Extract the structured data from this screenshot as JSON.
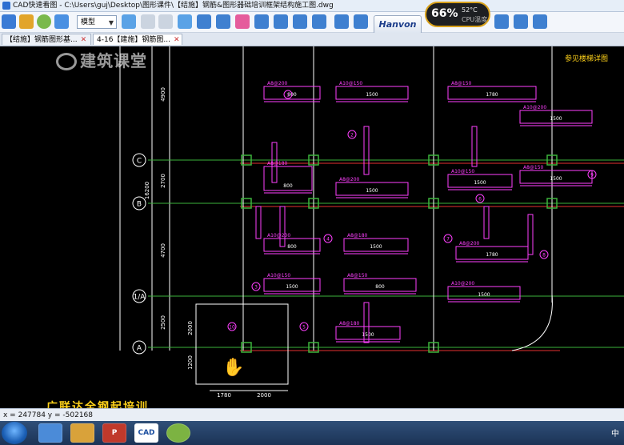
{
  "window": {
    "title": "CAD快速看图 - C:\\Users\\guj\\Desktop\\图形课件\\【结施】钢筋&图形器础培训框架结构施工图.dwg"
  },
  "toolbar": {
    "mode_label": "模型",
    "brand_label": "Hanvon"
  },
  "cpu_widget": {
    "percent": "66%",
    "temperature": "52°C",
    "label": "CPU温度"
  },
  "tabs": [
    {
      "label": "【结施】钢筋图形基..."
    },
    {
      "label": "4-16【建施】钢筋图..."
    }
  ],
  "logo": {
    "text": "建筑课堂"
  },
  "drawing": {
    "axis_labels": [
      "C",
      "B",
      "1/A",
      "A"
    ],
    "dims_left": [
      "4900",
      "2700",
      "4700",
      "2500",
      "1200",
      "2000",
      "16200"
    ],
    "dims_bottom": [
      "1780",
      "2000"
    ],
    "note": "参见楼梯详图",
    "rebar_labels": [
      "A8@200",
      "A10@150",
      "A8@150",
      "A10@200",
      "A8@180"
    ],
    "numbers": [
      "800",
      "1500",
      "1780",
      "1500",
      "800",
      "1500",
      "1500",
      "1500"
    ],
    "circles": [
      "1",
      "2",
      "3",
      "4",
      "5",
      "6",
      "7",
      "8",
      "9",
      "10"
    ]
  },
  "statusbar": {
    "coords": "x = 247784   y = -502168"
  },
  "watermark": {
    "text": "广联达全钢起培训"
  },
  "taskbar": {
    "items": [
      "IE",
      "Explorer",
      "PowerPoint",
      "CAD",
      "Other"
    ]
  },
  "colors": {
    "accent": "#d7a01a",
    "grid": "#3cb43c",
    "rebar": "#ff40ff",
    "lines": "#ffffff"
  }
}
